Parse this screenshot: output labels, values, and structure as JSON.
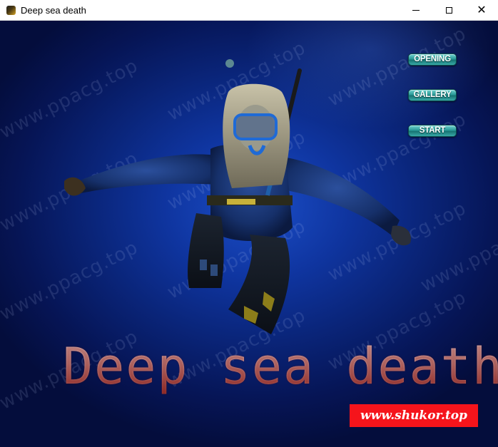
{
  "window": {
    "title": "Deep sea death",
    "controls": {
      "minimize_icon": "minimize-icon",
      "maximize_icon": "maximize-icon",
      "close_glyph": "✕"
    }
  },
  "game": {
    "watermark_text": "www.ppacg.top",
    "menu": {
      "opening": "OPENING",
      "gallery": "GALLERY",
      "start": "START"
    },
    "title": "Deep sea death",
    "site_badge": "www.shukor.top"
  },
  "colors": {
    "sea_deep": "#061556",
    "sea_light": "#1b4ec8",
    "button_teal": "#2a9a98",
    "badge_red": "#f5141b"
  }
}
